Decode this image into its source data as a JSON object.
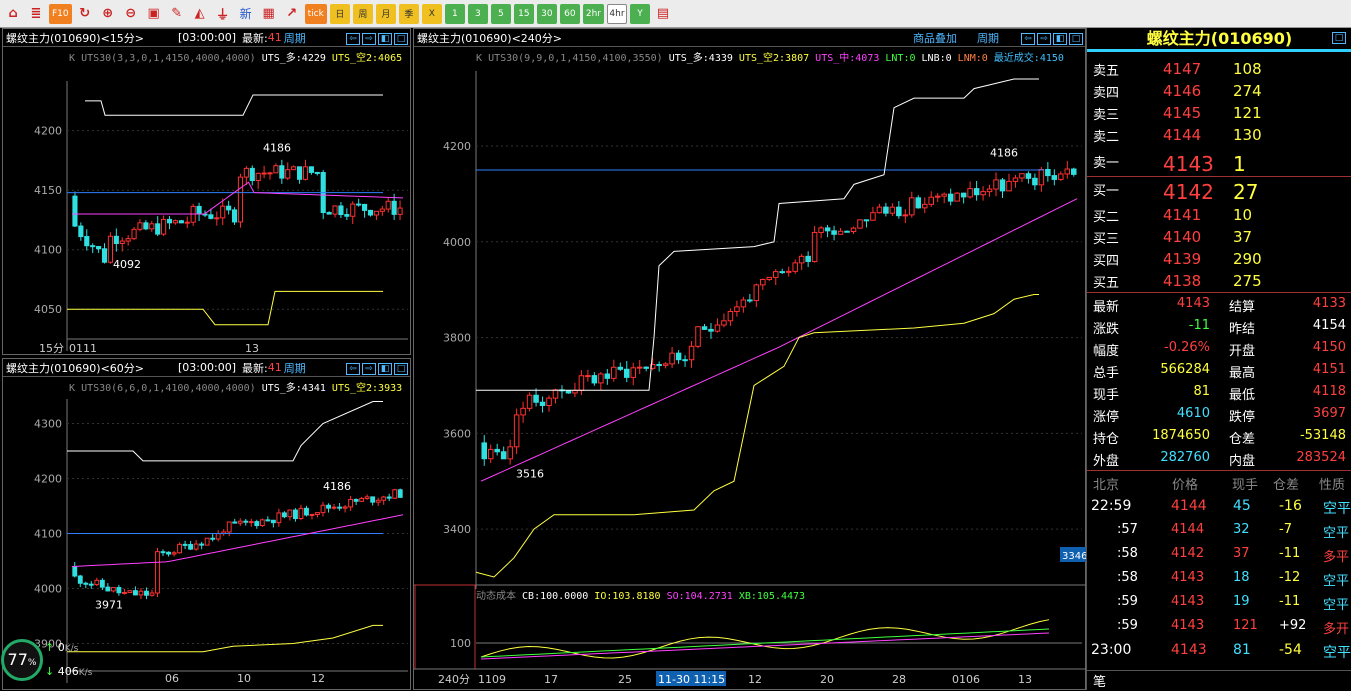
{
  "toolbar": {
    "items": [
      "home",
      "layers",
      "f10",
      "refresh",
      "zoom-in",
      "zoom-out",
      "window",
      "pen",
      "paint",
      "filter",
      "新",
      "table",
      "chart",
      "tick",
      "日",
      "周",
      "月",
      "季",
      "X",
      "1",
      "3",
      "5",
      "15",
      "30",
      "60",
      "2hr",
      "4hr",
      "Y",
      "grid"
    ]
  },
  "p1": {
    "title": "螺纹主力(010690)<15分>",
    "time": "[03:00:00]",
    "latest_label": "最新:",
    "latest": "41",
    "period": "周期",
    "ind_k": "K",
    "ind_name": "UTS30(3,3,0,1,4150,4000,4000)",
    "ind_a": "UTS_多:4229",
    "ind_b": "UTS_空2:4065",
    "y": [
      "4200",
      "4150",
      "4100",
      "4050"
    ],
    "x": [
      "15分",
      "0111",
      "13"
    ],
    "hi": "4186",
    "lo": "4092"
  },
  "p2": {
    "title": "螺纹主力(010690)<60分>",
    "time": "[03:00:00]",
    "latest_label": "最新:",
    "latest": "41",
    "period": "周期",
    "ind_k": "K",
    "ind_name": "UTS30(6,6,0,1,4100,4000,4000)",
    "ind_a": "UTS_多:4341",
    "ind_b": "UTS_空2:3933",
    "y": [
      "4300",
      "4200",
      "4100",
      "4000",
      "3900"
    ],
    "x": [
      "06",
      "10",
      "12"
    ],
    "hi": "4186",
    "lo": "3971"
  },
  "p3": {
    "title": "螺纹主力(010690)<240分>",
    "overlay": "商品叠加",
    "period": "周期",
    "ind_k": "K",
    "ind_name": "UTS30(9,9,0,1,4150,4100,3550)",
    "ind_a": "UTS_多:4339",
    "ind_b": "UTS_空2:3807",
    "ind_c": "UTS_中:4073",
    "lnt": "LNT:0",
    "lnb": "LNB:0",
    "lnm": "LNM:0",
    "recent": "最近成交:4150",
    "y": [
      "4200",
      "4000",
      "3800",
      "3600",
      "3400"
    ],
    "hi": "4186",
    "lo": "3516",
    "tag": "3346",
    "sub_title": "动态成本",
    "cb": "CB:100.0000",
    "io": "IO:103.8180",
    "so": "SO:104.2731",
    "xb": "XB:105.4473",
    "sub_y": "100",
    "x": [
      "240分",
      "1109",
      "17",
      "25",
      "11-30 11:15",
      "12",
      "20",
      "28",
      "0106",
      "13"
    ]
  },
  "right": {
    "title": "螺纹主力(010690)",
    "asks": [
      {
        "l": "卖五",
        "p": "4147",
        "v": "108"
      },
      {
        "l": "卖四",
        "p": "4146",
        "v": "274"
      },
      {
        "l": "卖三",
        "p": "4145",
        "v": "121"
      },
      {
        "l": "卖二",
        "p": "4144",
        "v": "130"
      },
      {
        "l": "卖一",
        "p": "4143",
        "v": "1"
      }
    ],
    "bids": [
      {
        "l": "买一",
        "p": "4142",
        "v": "27"
      },
      {
        "l": "买二",
        "p": "4141",
        "v": "10"
      },
      {
        "l": "买三",
        "p": "4140",
        "v": "37"
      },
      {
        "l": "买四",
        "p": "4139",
        "v": "290"
      },
      {
        "l": "买五",
        "p": "4138",
        "v": "275"
      }
    ],
    "stats": [
      [
        "最新",
        "4143",
        "结算",
        "4133"
      ],
      [
        "涨跌",
        "-11",
        "昨结",
        "4154"
      ],
      [
        "幅度",
        "-0.26%",
        "开盘",
        "4150"
      ],
      [
        "总手",
        "566284",
        "最高",
        "4151"
      ],
      [
        "现手",
        "81",
        "最低",
        "4118"
      ],
      [
        "涨停",
        "4610",
        "跌停",
        "3697"
      ],
      [
        "持仓",
        "1874650",
        "仓差",
        "-53148"
      ],
      [
        "外盘",
        "282760",
        "内盘",
        "283524"
      ]
    ],
    "tick_hdr": [
      "北京",
      "价格",
      "现手",
      "仓差",
      "性质"
    ],
    "ticks": [
      [
        "22:59",
        "4144",
        "45",
        "-16",
        "空平"
      ],
      [
        ":57",
        "4144",
        "32",
        "-7",
        "空平"
      ],
      [
        ":58",
        "4142",
        "37",
        "-11",
        "多平"
      ],
      [
        ":58",
        "4143",
        "18",
        "-12",
        "空平"
      ],
      [
        ":59",
        "4143",
        "19",
        "-11",
        "空平"
      ],
      [
        ":59",
        "4143",
        "121",
        "+92",
        "多开"
      ],
      [
        "23:00",
        "4143",
        "81",
        "-54",
        "空平"
      ]
    ],
    "bottom": "笔"
  },
  "status": {
    "pct": "77",
    "pct_unit": "%",
    "up": "0",
    "up_unit": "K/s",
    "down": "406",
    "down_unit": "K/s"
  }
}
